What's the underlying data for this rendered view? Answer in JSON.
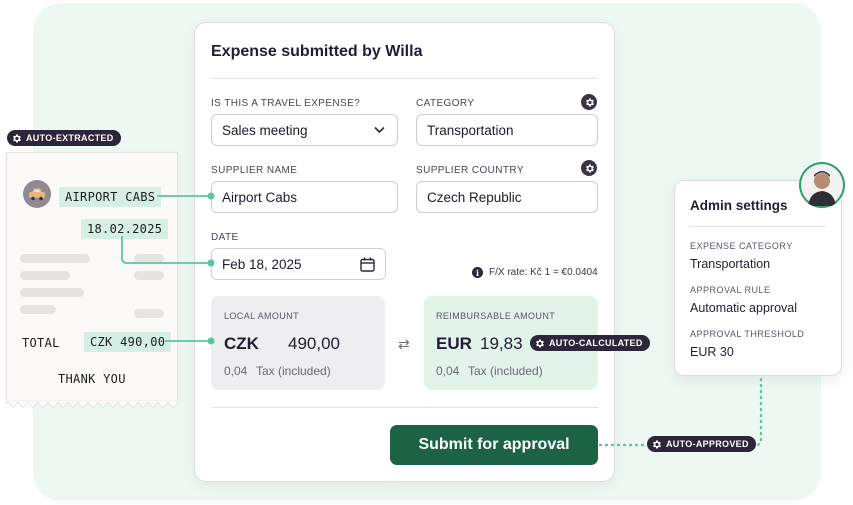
{
  "receipt": {
    "badge": "AUTO-EXTRACTED",
    "supplier": "AIRPORT CABS",
    "date": "18.02.2025",
    "total_label": "TOTAL",
    "total_value": "CZK 490,00",
    "footer": "THANK YOU"
  },
  "form": {
    "title": "Expense submitted by Willa",
    "travel_label": "IS THIS A TRAVEL EXPENSE?",
    "travel_value": "Sales meeting",
    "category_label": "CATEGORY",
    "category_value": "Transportation",
    "supplier_label": "SUPPLIER NAME",
    "supplier_value": "Airport Cabs",
    "country_label": "SUPPLIER COUNTRY",
    "country_value": "Czech Republic",
    "date_label": "DATE",
    "date_value": "Feb 18, 2025",
    "fx_rate": "F/X rate: Kč 1 = €0.0404",
    "local": {
      "label": "LOCAL AMOUNT",
      "currency": "CZK",
      "value": "490,00",
      "tax_value": "0,04",
      "tax_label": "Tax (included)"
    },
    "reimbursable": {
      "label": "REIMBURSABLE AMOUNT",
      "currency": "EUR",
      "value": "19,83",
      "tax_value": "0,04",
      "tax_label": "Tax (included)",
      "badge": "AUTO-CALCULATED"
    },
    "submit_label": "Submit for approval",
    "approved_badge": "AUTO-APPROVED"
  },
  "admin": {
    "title": "Admin settings",
    "category_label": "EXPENSE CATEGORY",
    "category_value": "Transportation",
    "rule_label": "APPROVAL RULE",
    "rule_value": "Automatic approval",
    "threshold_label": "APPROVAL THRESHOLD",
    "threshold_value": "EUR 30"
  },
  "colors": {
    "accent_green": "#1c6346",
    "highlight": "#d5efe2",
    "badge_dark": "#2d2638",
    "panel_bg": "#eef8f3",
    "connector": "#5cc79a"
  }
}
